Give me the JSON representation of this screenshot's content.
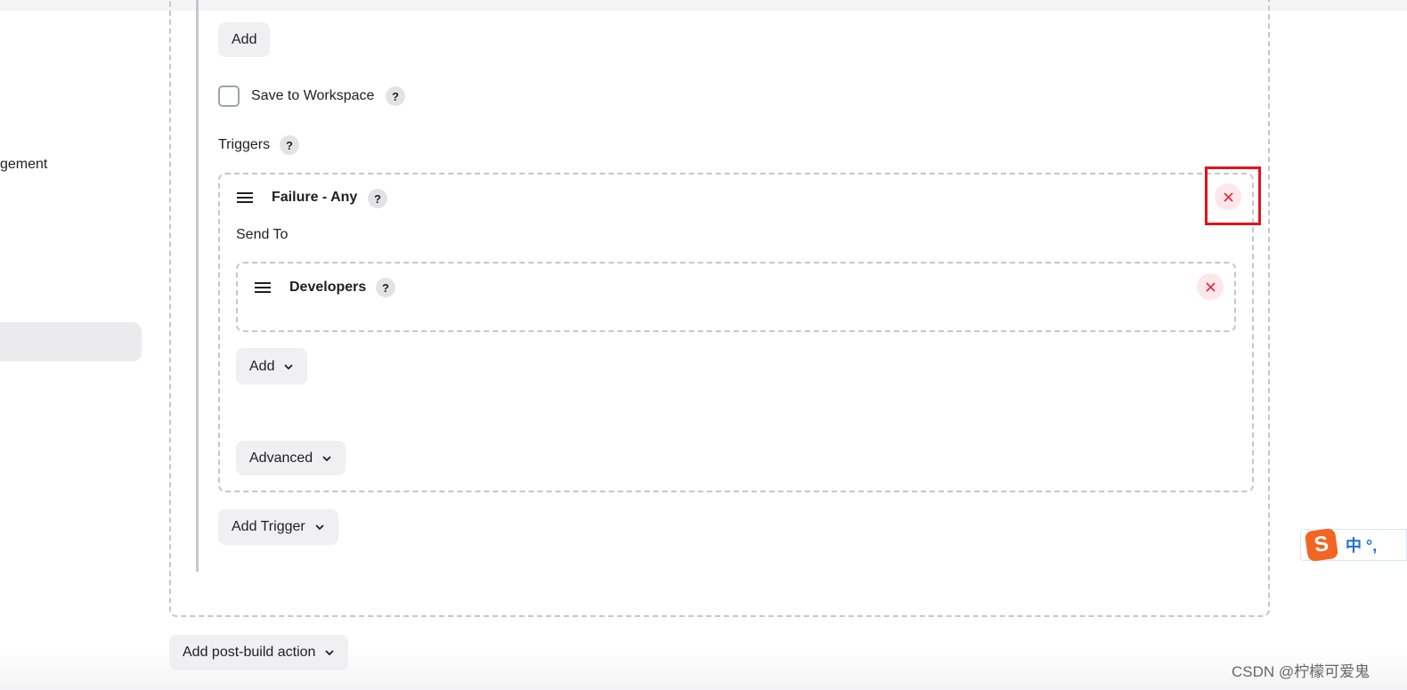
{
  "sidebar": {
    "partial_item_label": "gement"
  },
  "form": {
    "add_label": "Add",
    "save_workspace_label": "Save to Workspace",
    "triggers_label": "Triggers",
    "help_glyph": "?",
    "trigger": {
      "title": "Failure - Any",
      "send_to_label": "Send To",
      "recipient": {
        "title": "Developers"
      },
      "add_label": "Add",
      "advanced_label": "Advanced"
    },
    "add_trigger_label": "Add Trigger",
    "add_post_build_label": "Add post-build action"
  },
  "overlay": {
    "ime_logo": "S",
    "ime_text": "中 °,",
    "watermark": "CSDN @柠檬可爱鬼"
  },
  "colors": {
    "highlight": "#e4111c",
    "close_icon": "#e0283a",
    "button_bg": "#f0f0f2",
    "dashed_border": "#c4c7cc"
  }
}
